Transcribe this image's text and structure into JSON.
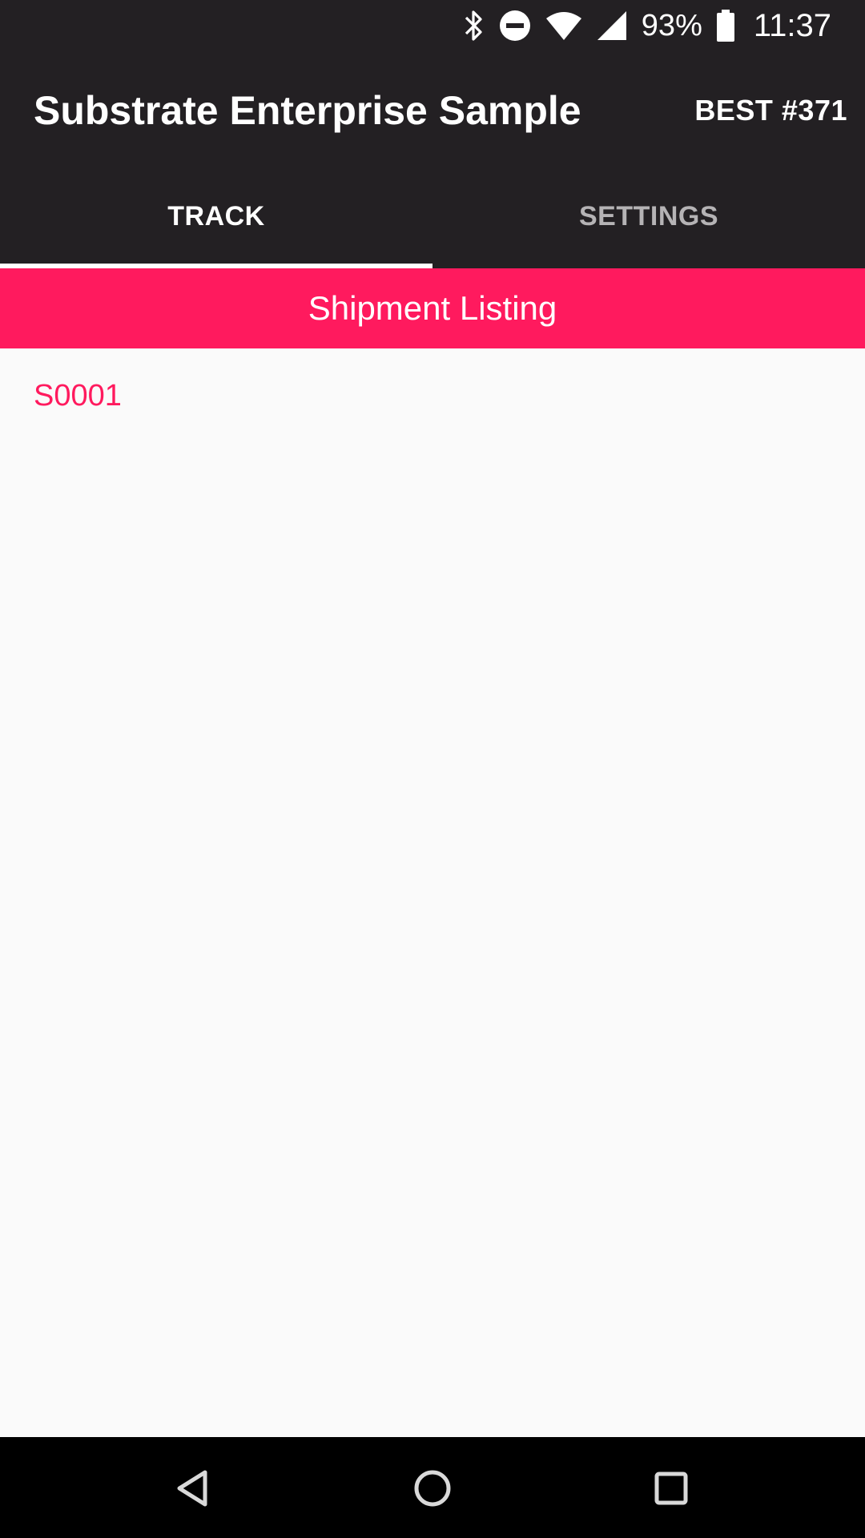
{
  "status_bar": {
    "battery_percent": "93%",
    "time": "11:37",
    "icons": [
      "bluetooth-icon",
      "do-not-disturb-icon",
      "wifi-icon",
      "cell-signal-icon",
      "battery-icon"
    ]
  },
  "app_bar": {
    "title": "Substrate Enterprise Sample",
    "badge": "BEST #371"
  },
  "tabs": [
    {
      "label": "TRACK",
      "active": true
    },
    {
      "label": "SETTINGS",
      "active": false
    }
  ],
  "section": {
    "title": "Shipment Listing"
  },
  "shipments": [
    {
      "id": "S0001"
    }
  ],
  "nav_bar": {
    "icons": [
      "back-icon",
      "home-icon",
      "recents-icon"
    ]
  },
  "colors": {
    "bar_background": "#232023",
    "accent": "#ff1a5e",
    "content_background": "#fafafa",
    "tab_inactive": "#b5b3b5"
  }
}
